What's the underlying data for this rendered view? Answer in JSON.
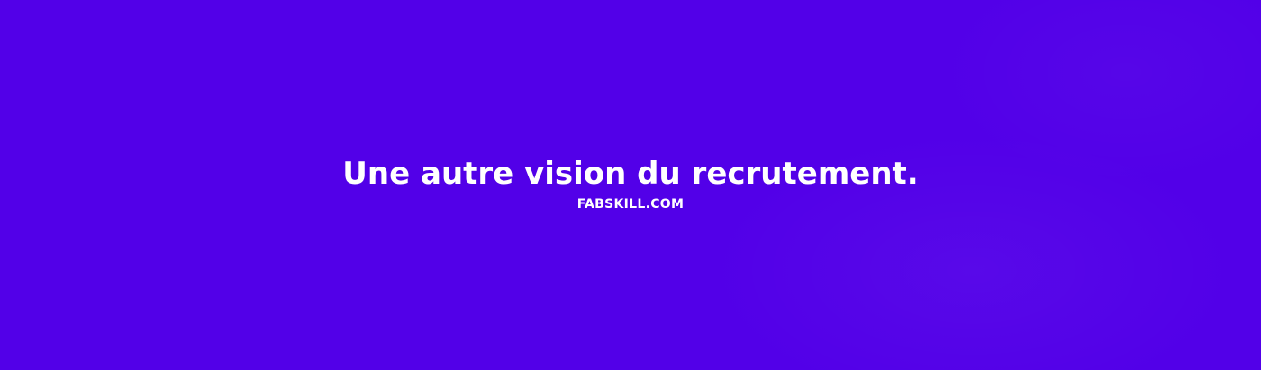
{
  "banner": {
    "tagline": "Une autre vision du recrutement.",
    "domain": "FABSKILL.COM",
    "colors": {
      "background": "#5200E8",
      "text": "#FFFFFF"
    }
  }
}
